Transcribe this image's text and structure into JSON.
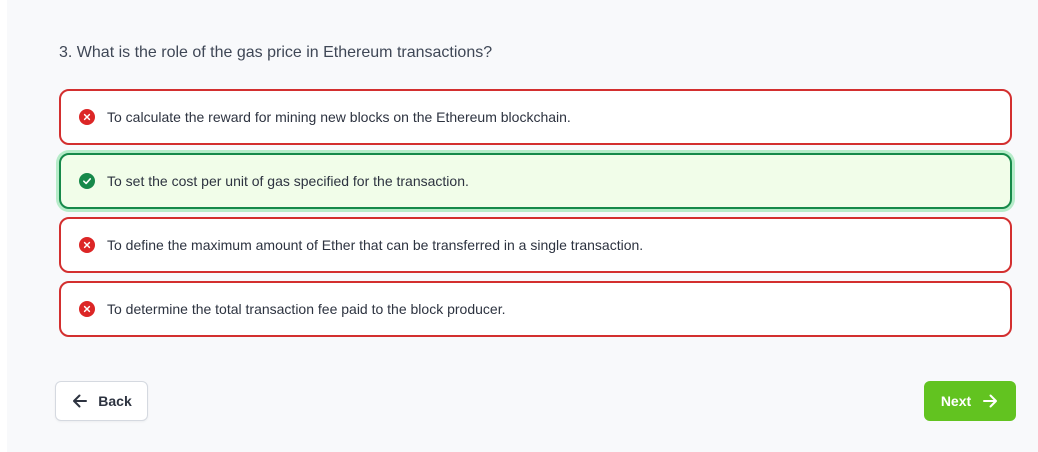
{
  "question": {
    "text": "3. What is the role of the gas price in Ethereum transactions?"
  },
  "options": [
    {
      "label": "To calculate the reward for mining new blocks on the Ethereum blockchain.",
      "state": "incorrect",
      "icon": "x-circle-icon"
    },
    {
      "label": "To set the cost per unit of gas specified for the transaction.",
      "state": "correct",
      "icon": "check-circle-icon"
    },
    {
      "label": "To define the maximum amount of Ether that can be transferred in a single transaction.",
      "state": "incorrect",
      "icon": "x-circle-icon"
    },
    {
      "label": "To determine the total transaction fee paid to the block producer.",
      "state": "incorrect",
      "icon": "x-circle-icon"
    }
  ],
  "navigation": {
    "back_label": "Back",
    "back_icon": "arrow-left-icon",
    "next_label": "Next",
    "next_icon": "arrow-right-icon"
  },
  "colors": {
    "incorrect": "#dc2626",
    "correct": "#16894a",
    "correct_background": "#f1fde9",
    "next_button": "#62c320"
  }
}
